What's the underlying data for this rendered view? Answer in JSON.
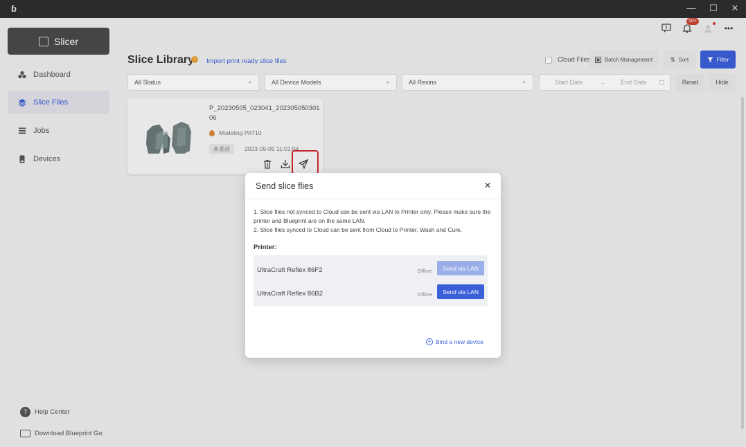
{
  "titlebar": {
    "logo": "ɓ",
    "controls": [
      "—",
      "☐",
      "✕"
    ]
  },
  "sidebar": {
    "slicer_label": "Slicer",
    "items": [
      {
        "label": "Dashboard",
        "icon": "dashboard-icon"
      },
      {
        "label": "Slice Files",
        "icon": "layers-icon",
        "active": true
      },
      {
        "label": "Jobs",
        "icon": "jobs-icon"
      },
      {
        "label": "Devices",
        "icon": "devices-icon"
      }
    ],
    "help_center": "Help Center",
    "download": "Download Blueprint Go"
  },
  "header": {
    "badge": "10+",
    "title": "Slice Library",
    "import_link": "Import print ready slice files",
    "cloud_files": "Cloud Files",
    "batch_management": "Batch Management",
    "sort": "Sort",
    "filter": "Filter"
  },
  "filters": {
    "status": "All Status",
    "device_models": "All Device Models",
    "resins": "All Resins",
    "start_date": "Start Date",
    "end_date": "End Date",
    "reset": "Reset",
    "hide": "Hide"
  },
  "card": {
    "name": "P_20230505_023041_20230505030106",
    "resin": "Modeling PAT10",
    "status": "未发送",
    "date": "2023-05-05 11:01:04"
  },
  "modal": {
    "title": "Send slice flies",
    "note1": "1. Slice files not synced to Cloud can be sent via LAN to Printer only. Please make sure the printer and Blueprint are on the same LAN.",
    "note2": "2. Slice files synced to Cloud can be sent from Cloud to Printer, Wash and Cure.",
    "printer_label": "Printer:",
    "printers": [
      {
        "name": "UltraCraft Reflex 86F2",
        "status": "Offline",
        "button": "Send via LAN",
        "enabled": false
      },
      {
        "name": "UltraCraft Reflex 86B2",
        "status": "Offline",
        "button": "Send via LAN",
        "enabled": true
      }
    ],
    "bind_link": "Bind a new device"
  },
  "colors": {
    "accent": "#3b5fd9",
    "highlight": "#c0282d",
    "sidebar_active": "#e2e2e8"
  }
}
